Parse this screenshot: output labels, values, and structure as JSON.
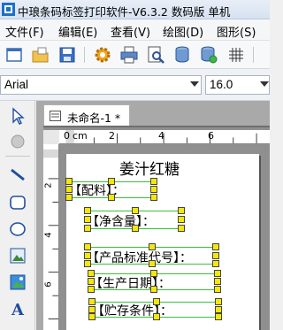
{
  "window": {
    "title": "中琅条码标签打印软件-V6.3.2 数码版 单机"
  },
  "menu": [
    {
      "label": "文件(F)"
    },
    {
      "label": "编辑(E)"
    },
    {
      "label": "查看(V)"
    },
    {
      "label": "绘图(D)"
    },
    {
      "label": "图形(S)"
    }
  ],
  "toolbar": {
    "items": [
      "new-icon",
      "open-icon",
      "save-icon",
      "settings-icon",
      "print-icon",
      "print-preview-icon",
      "database-icon",
      "database-setting-icon",
      "grid-icon"
    ]
  },
  "font": {
    "family": "Arial",
    "size": "16.0"
  },
  "tools": [
    "pointer-icon",
    "pan-icon",
    "line-icon",
    "rounded-rect-icon",
    "ellipse-icon",
    "image-icon",
    "picture-icon",
    "text-icon"
  ],
  "document": {
    "tab_label": "未命名-1 *"
  },
  "ruler": {
    "unit_label": "cm",
    "ticks_top": [
      "0",
      "2",
      "4",
      "6"
    ],
    "ticks_left": [
      "2",
      "4",
      "6"
    ]
  },
  "label": {
    "title": "姜汁红糖",
    "fields": [
      {
        "text": "【配料】："
      },
      {
        "text": "【净含量】："
      },
      {
        "text": "【产品标准代号】："
      },
      {
        "text": "【生产日期】："
      },
      {
        "text": "【贮存条件】："
      }
    ]
  },
  "colors": {
    "selection": "#3ac03a",
    "handle": "#f4e70c",
    "workspace": "#a9a9a9"
  }
}
